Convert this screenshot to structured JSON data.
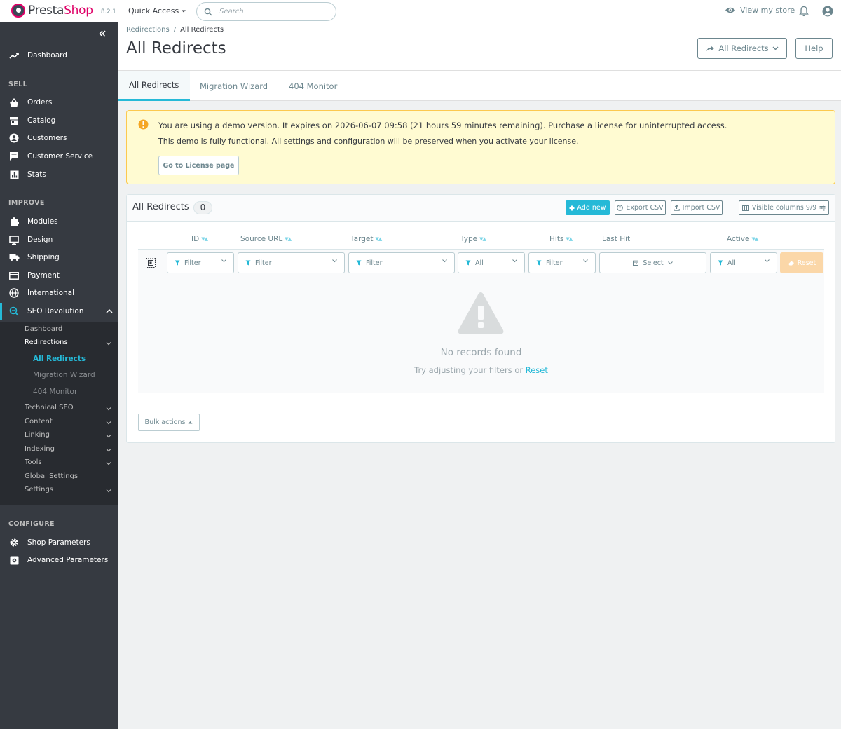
{
  "app": {
    "brand_a": "Presta",
    "brand_b": "Shop",
    "version": "8.2.1"
  },
  "topbar": {
    "quick_access": "Quick Access",
    "search_placeholder": "Search",
    "view_store": "View my store"
  },
  "sidebar": {
    "dashboard": "Dashboard",
    "section_sell": "SELL",
    "orders": "Orders",
    "catalog": "Catalog",
    "customers": "Customers",
    "customer_service": "Customer Service",
    "stats": "Stats",
    "section_improve": "IMPROVE",
    "modules": "Modules",
    "design": "Design",
    "shipping": "Shipping",
    "payment": "Payment",
    "international": "International",
    "seo_revolution": "SEO Revolution",
    "sub": {
      "dashboard": "Dashboard",
      "redirections": "Redirections",
      "all_redirects": "All Redirects",
      "migration_wizard": "Migration Wizard",
      "monitor_404": "404 Monitor",
      "technical_seo": "Technical SEO",
      "content": "Content",
      "linking": "Linking",
      "indexing": "Indexing",
      "tools": "Tools",
      "global_settings": "Global Settings",
      "settings": "Settings"
    },
    "section_configure": "CONFIGURE",
    "shop_parameters": "Shop Parameters",
    "advanced_parameters": "Advanced Parameters"
  },
  "header": {
    "breadcrumb_parent": "Redirections",
    "breadcrumb_sep": "/",
    "breadcrumb_current": "All Redirects",
    "title": "All Redirects",
    "all_redirects_button": "All Redirects",
    "help_button": "Help"
  },
  "tabs": [
    "All Redirects",
    "Migration Wizard",
    "404 Monitor"
  ],
  "alert": {
    "line1": "You are using a demo version. It expires on 2026-06-07 09:58 (21 hours 59 minutes remaining). Purchase a license for uninterrupted access.",
    "line2": "This demo is fully functional. All settings and configuration will be preserved when you activate your license.",
    "button": "Go to License page"
  },
  "card": {
    "title": "All Redirects",
    "count": "0",
    "add_new": "Add new",
    "export_csv": "Export CSV",
    "import_csv": "Import CSV",
    "visible_columns": "Visible columns 9/9",
    "columns": [
      "ID",
      "Source URL",
      "Target",
      "Type",
      "Hits",
      "Last Hit",
      "Active"
    ],
    "filters": {
      "id": "Filter",
      "source": "Filter",
      "target": "Filter",
      "type": "All",
      "hits": "Filter",
      "last_hit": "Select",
      "active": "All",
      "reset": "Reset"
    },
    "empty_title": "No records found",
    "empty_sub": "Try adjusting your filters or",
    "empty_reset": "Reset",
    "bulk_actions": "Bulk actions"
  }
}
